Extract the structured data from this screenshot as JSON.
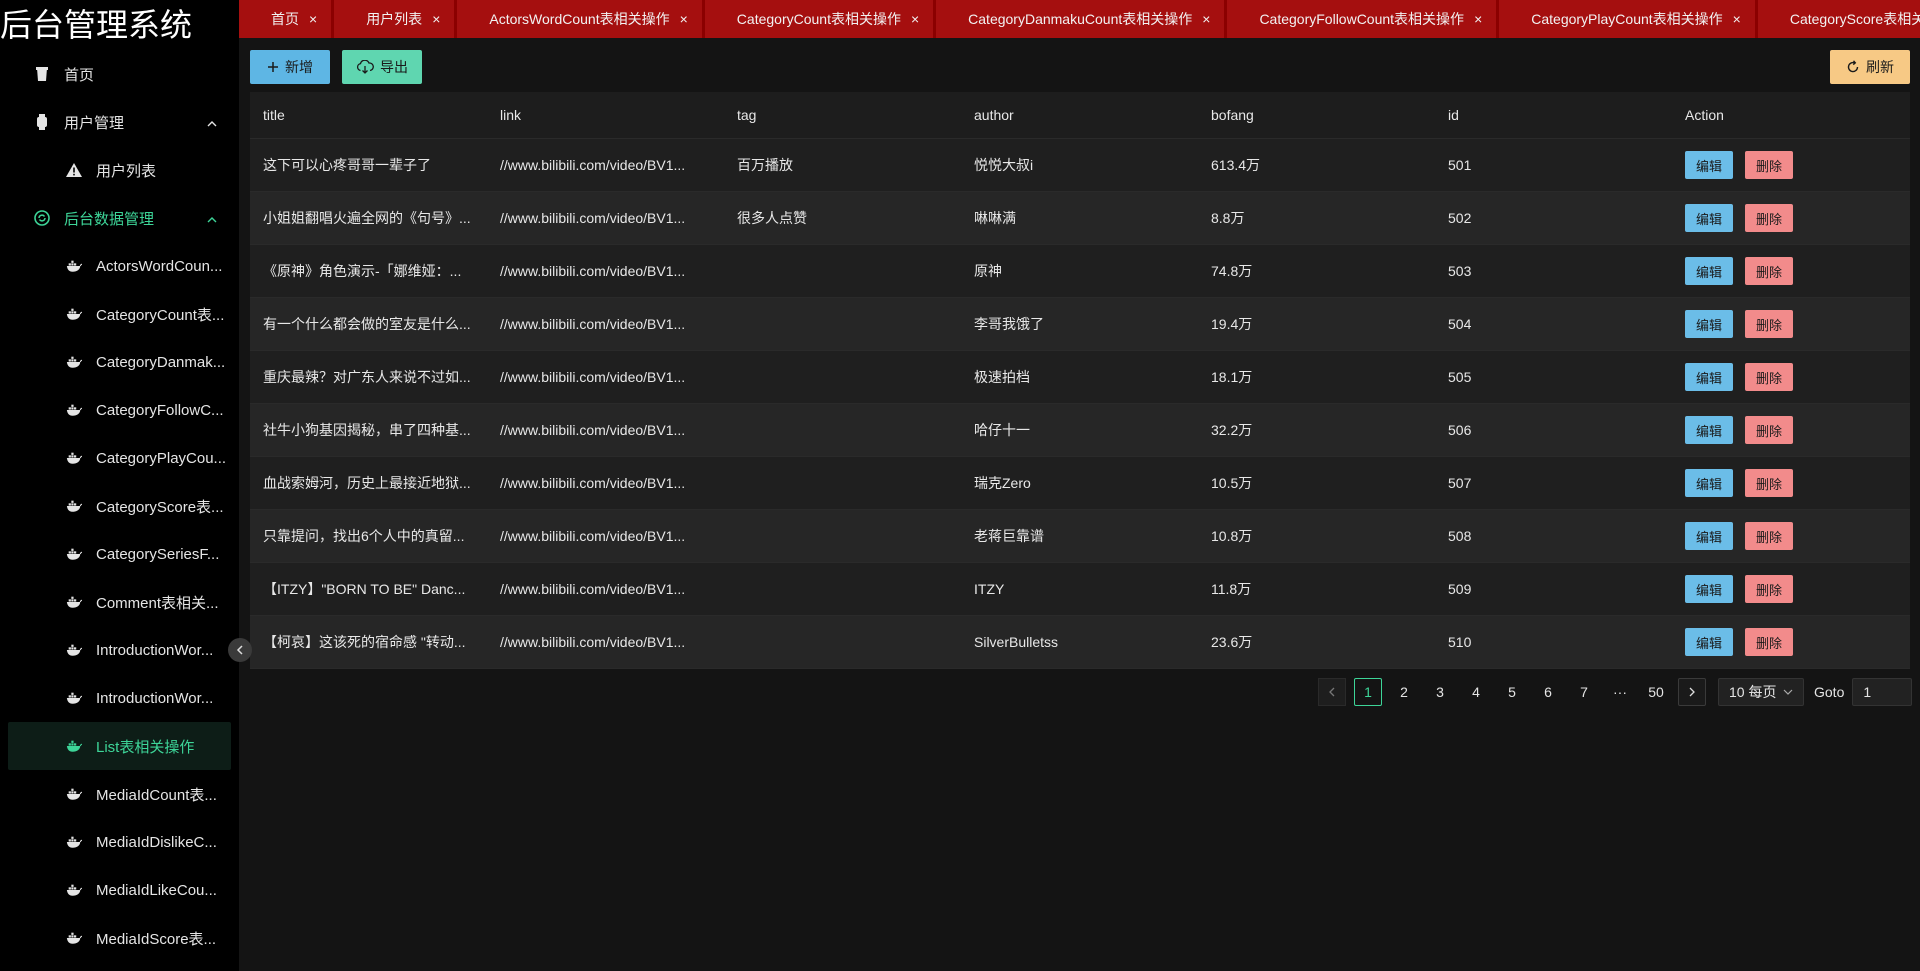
{
  "app": {
    "title": "后台管理系统"
  },
  "sidebar": {
    "items": [
      {
        "label": "首页",
        "icon": "cup-icon",
        "level": 1
      },
      {
        "label": "用户管理",
        "icon": "watch-icon",
        "level": 1,
        "expandable": true
      },
      {
        "label": "用户列表",
        "icon": "warning-icon",
        "level": 2
      },
      {
        "label": "后台数据管理",
        "icon": "refresh-circle-icon",
        "level": 1,
        "expandable": true,
        "highlight": true
      },
      {
        "label": "ActorsWordCoun...",
        "icon": "docker-icon",
        "level": 2
      },
      {
        "label": "CategoryCount表...",
        "icon": "docker-icon",
        "level": 2
      },
      {
        "label": "CategoryDanmak...",
        "icon": "docker-icon",
        "level": 2
      },
      {
        "label": "CategoryFollowC...",
        "icon": "docker-icon",
        "level": 2
      },
      {
        "label": "CategoryPlayCou...",
        "icon": "docker-icon",
        "level": 2
      },
      {
        "label": "CategoryScore表...",
        "icon": "docker-icon",
        "level": 2
      },
      {
        "label": "CategorySeriesF...",
        "icon": "docker-icon",
        "level": 2
      },
      {
        "label": "Comment表相关...",
        "icon": "docker-icon",
        "level": 2
      },
      {
        "label": "IntroductionWor...",
        "icon": "docker-icon",
        "level": 2
      },
      {
        "label": "IntroductionWor...",
        "icon": "docker-icon",
        "level": 2
      },
      {
        "label": "List表相关操作",
        "icon": "docker-icon",
        "level": 2,
        "active": true
      },
      {
        "label": "MediaIdCount表...",
        "icon": "docker-icon",
        "level": 2
      },
      {
        "label": "MediaIdDislikeC...",
        "icon": "docker-icon",
        "level": 2
      },
      {
        "label": "MediaIdLikeCou...",
        "icon": "docker-icon",
        "level": 2
      },
      {
        "label": "MediaIdScore表...",
        "icon": "docker-icon",
        "level": 2
      }
    ]
  },
  "tabs": [
    {
      "label": "首页",
      "close": "×"
    },
    {
      "label": "用户列表",
      "close": "×"
    },
    {
      "label": "ActorsWordCount表相关操作",
      "close": "×"
    },
    {
      "label": "CategoryCount表相关操作",
      "close": "×"
    },
    {
      "label": "CategoryDanmakuCount表相关操作",
      "close": "×"
    },
    {
      "label": "CategoryFollowCount表相关操作",
      "close": "×"
    },
    {
      "label": "CategoryPlayCount表相关操作",
      "close": "×"
    },
    {
      "label": "CategoryScore表相关操作",
      "close": "×"
    }
  ],
  "toolbar": {
    "add_label": "新增",
    "export_label": "导出",
    "refresh_label": "刷新"
  },
  "table": {
    "columns": [
      "title",
      "link",
      "tag",
      "author",
      "bofang",
      "id",
      "Action"
    ],
    "edit_label": "编辑",
    "delete_label": "删除",
    "rows": [
      {
        "title": "这下可以心疼哥哥一辈子了",
        "link": "//www.bilibili.com/video/BV1...",
        "tag": "百万播放",
        "author": "悦悦大叔i",
        "bofang": "613.4万",
        "id": "501"
      },
      {
        "title": "小姐姐翻唱火遍全网的《句号》...",
        "link": "//www.bilibili.com/video/BV1...",
        "tag": "很多人点赞",
        "author": "啉啉满",
        "bofang": "8.8万",
        "id": "502"
      },
      {
        "title": "《原神》角色演示-「娜维娅：...",
        "link": "//www.bilibili.com/video/BV1...",
        "tag": "",
        "author": "原神",
        "bofang": "74.8万",
        "id": "503"
      },
      {
        "title": "有一个什么都会做的室友是什么...",
        "link": "//www.bilibili.com/video/BV1...",
        "tag": "",
        "author": "李哥我饿了",
        "bofang": "19.4万",
        "id": "504"
      },
      {
        "title": "重庆最辣？对广东人来说不过如...",
        "link": "//www.bilibili.com/video/BV1...",
        "tag": "",
        "author": "极速拍档",
        "bofang": "18.1万",
        "id": "505"
      },
      {
        "title": "社牛小狗基因揭秘，串了四种基...",
        "link": "//www.bilibili.com/video/BV1...",
        "tag": "",
        "author": "哈仔十一",
        "bofang": "32.2万",
        "id": "506"
      },
      {
        "title": "血战索姆河，历史上最接近地狱...",
        "link": "//www.bilibili.com/video/BV1...",
        "tag": "",
        "author": "瑞克Zero",
        "bofang": "10.5万",
        "id": "507"
      },
      {
        "title": "只靠提问，找出6个人中的真留...",
        "link": "//www.bilibili.com/video/BV1...",
        "tag": "",
        "author": "老蒋巨靠谱",
        "bofang": "10.8万",
        "id": "508"
      },
      {
        "title": "【ITZY】\"BORN TO BE\" Danc...",
        "link": "//www.bilibili.com/video/BV1...",
        "tag": "",
        "author": "ITZY",
        "bofang": "11.8万",
        "id": "509"
      },
      {
        "title": "【柯哀】这该死的宿命感 \"转动...",
        "link": "//www.bilibili.com/video/BV1...",
        "tag": "",
        "author": "SilverBulletss",
        "bofang": "23.6万",
        "id": "510"
      }
    ]
  },
  "pagination": {
    "pages": [
      "1",
      "2",
      "3",
      "4",
      "5",
      "6",
      "7",
      "···",
      "50"
    ],
    "current": "1",
    "page_size": "10 每页",
    "goto_label": "Goto",
    "goto_value": "1"
  }
}
